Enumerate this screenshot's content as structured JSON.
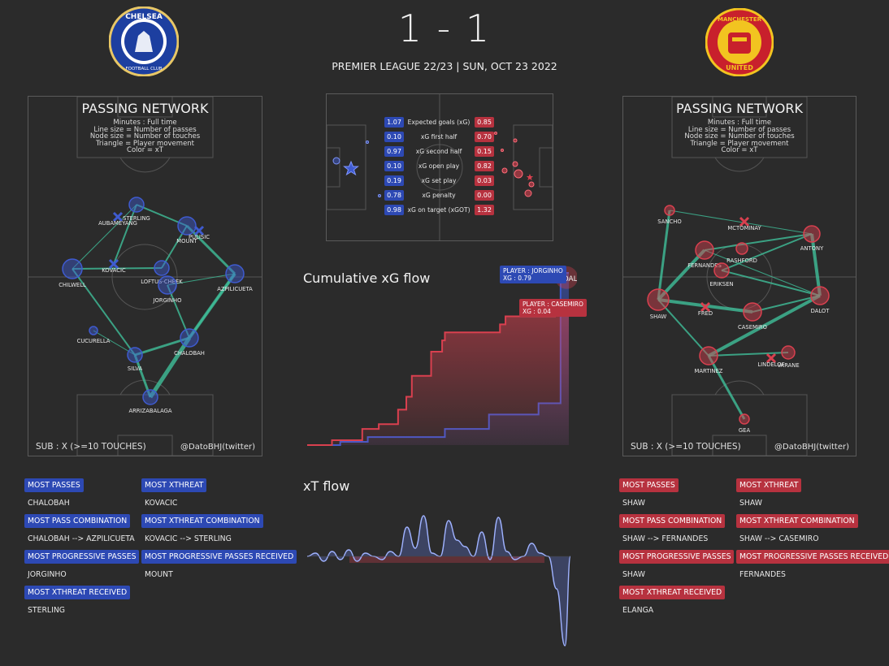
{
  "header": {
    "score": "1 - 1",
    "subtitle": "PREMIER LEAGUE 22/23 | SUN, OCT 23 2022",
    "home_crest_text": [
      "CHELSEA",
      "FOOTBALL CLUB"
    ],
    "away_crest_text": [
      "MANCHESTER",
      "UNITED"
    ]
  },
  "colors": {
    "background": "#2b2b2b",
    "home": "#3f5bd0",
    "away": "#d9404f",
    "link": "#3fbf9a"
  },
  "home_network": {
    "title": "PASSING NETWORK",
    "legend": [
      "Minutes : Full time",
      "Line size = Number of passes",
      "Node size = Number of touches",
      "Triangle = Player movement",
      "Color = xT"
    ],
    "sub_note": "SUB : X (>=10 TOUCHES)",
    "credit": "@DatoBHJ(twitter)",
    "players": [
      {
        "name": "STERLING"
      },
      {
        "name": "AUBAMEYANG"
      },
      {
        "name": "MOUNT"
      },
      {
        "name": "PULISIC"
      },
      {
        "name": "CHILWELL"
      },
      {
        "name": "KOVACIC"
      },
      {
        "name": "LOFTUS-CHEEK"
      },
      {
        "name": "AZPILICUETA"
      },
      {
        "name": "JORGINHO"
      },
      {
        "name": "CUCURELLA"
      },
      {
        "name": "CHALOBAH"
      },
      {
        "name": "SILVA"
      },
      {
        "name": "ARRIZABALAGA"
      }
    ]
  },
  "away_network": {
    "title": "PASSING NETWORK",
    "legend": [
      "Minutes : Full time",
      "Line size = Number of passes",
      "Node size = Number of touches",
      "Triangle = Player movement",
      "Color = xT"
    ],
    "sub_note": "SUB : X (>=10 TOUCHES)",
    "credit": "@DatoBHJ(twitter)",
    "players": [
      {
        "name": "SANCHO"
      },
      {
        "name": "MCTOMINAY"
      },
      {
        "name": "ANTONY"
      },
      {
        "name": "FERNANDES"
      },
      {
        "name": "RASHFORD"
      },
      {
        "name": "ERIKSEN"
      },
      {
        "name": "SHAW"
      },
      {
        "name": "FRED"
      },
      {
        "name": "CASEMIRO"
      },
      {
        "name": "DALOT"
      },
      {
        "name": "MARTINEZ"
      },
      {
        "name": "VARANE"
      },
      {
        "name": "LINDELOF"
      },
      {
        "name": "GEA"
      }
    ]
  },
  "xg_table": {
    "rows": [
      {
        "label": "Expected goals (xG)",
        "home": "1.07",
        "away": "0.85"
      },
      {
        "label": "xG first half",
        "home": "0.10",
        "away": "0.70"
      },
      {
        "label": "xG second half",
        "home": "0.97",
        "away": "0.15"
      },
      {
        "label": "xG open play",
        "home": "0.10",
        "away": "0.82"
      },
      {
        "label": "xG set play",
        "home": "0.19",
        "away": "0.03"
      },
      {
        "label": "xG penalty",
        "home": "0.78",
        "away": "0.00"
      },
      {
        "label": "xG on target (xGOT)",
        "home": "0.98",
        "away": "1.32"
      }
    ]
  },
  "xg_flow": {
    "title": "Cumulative xG flow",
    "goal_label": "GOAL",
    "tooltip_home": [
      "PLAYER : JORGINHO",
      "XG : 0.79"
    ],
    "tooltip_away": [
      "PLAYER : CASEMIRO",
      "XG : 0.04"
    ]
  },
  "xt_flow": {
    "title": "xT flow"
  },
  "home_stats": [
    {
      "label": "MOST PASSES",
      "value": "CHALOBAH"
    },
    {
      "label": "MOST XTHREAT",
      "value": "KOVACIC"
    },
    {
      "label": "MOST PASS COMBINATION",
      "value": "CHALOBAH --> AZPILICUETA"
    },
    {
      "label": "MOST XTHREAT COMBINATION",
      "value": "KOVACIC --> STERLING"
    },
    {
      "label": "MOST PROGRESSIVE PASSES",
      "value": "JORGINHO"
    },
    {
      "label": "MOST PROGRESSIVE PASSES RECEIVED",
      "value": "MOUNT"
    },
    {
      "label": "MOST XTHREAT RECEIVED",
      "value": "STERLING"
    }
  ],
  "away_stats": [
    {
      "label": "MOST PASSES",
      "value": "SHAW"
    },
    {
      "label": "MOST XTHREAT",
      "value": "SHAW"
    },
    {
      "label": "MOST PASS COMBINATION",
      "value": "SHAW --> FERNANDES"
    },
    {
      "label": "MOST XTHREAT COMBINATION",
      "value": "SHAW --> CASEMIRO"
    },
    {
      "label": "MOST PROGRESSIVE PASSES",
      "value": "SHAW"
    },
    {
      "label": "MOST PROGRESSIVE PASSES RECEIVED",
      "value": "FERNANDES"
    },
    {
      "label": "MOST XTHREAT RECEIVED",
      "value": "ELANGA"
    }
  ],
  "chart_data": [
    {
      "type": "line",
      "title": "Cumulative xG flow",
      "series": [
        {
          "name": "",
          "color": "#3f5bd0",
          "points": [
            [
              0,
              0
            ],
            [
              12,
              0.02
            ],
            [
              22,
              0.05
            ],
            [
              35,
              0.05
            ],
            [
              50,
              0.1
            ],
            [
              62,
              0.1
            ],
            [
              66,
              0.19
            ],
            [
              80,
              0.19
            ],
            [
              84,
              0.26
            ],
            [
              91,
              0.26
            ],
            [
              92,
              1.07
            ],
            [
              95,
              1.07
            ]
          ]
        },
        {
          "name": "",
          "color": "#d9404f",
          "points": [
            [
              0,
              0
            ],
            [
              9,
              0.03
            ],
            [
              20,
              0.1
            ],
            [
              26,
              0.13
            ],
            [
              33,
              0.22
            ],
            [
              36,
              0.3
            ],
            [
              38,
              0.43
            ],
            [
              45,
              0.58
            ],
            [
              49,
              0.65
            ],
            [
              50,
              0.7
            ],
            [
              60,
              0.7
            ],
            [
              70,
              0.75
            ],
            [
              72,
              0.8
            ],
            [
              90,
              0.85
            ],
            [
              95,
              0.85
            ]
          ]
        }
      ],
      "ylim": [
        0,
        1.1
      ],
      "xlim": [
        0,
        95
      ]
    },
    {
      "type": "area",
      "title": "xT flow",
      "x": [
        0,
        3,
        6,
        9,
        12,
        15,
        18,
        21,
        24,
        27,
        30,
        33,
        36,
        39,
        42,
        45,
        48,
        51,
        54,
        57,
        60,
        63,
        66,
        69,
        72,
        75,
        78,
        81,
        84,
        87,
        90,
        93,
        95
      ],
      "values": [
        0,
        0.02,
        -0.03,
        0.03,
        -0.02,
        0.04,
        -0.03,
        0.02,
        0.0,
        -0.02,
        0.03,
        0.0,
        0.18,
        0.05,
        0.25,
        0.02,
        0.0,
        0.22,
        0.1,
        0.06,
        0.0,
        0.15,
        -0.02,
        0.24,
        0.03,
        -0.02,
        0.0,
        0.08,
        0.02,
        0.0,
        -0.2,
        -0.55,
        0.0
      ],
      "ylim": [
        -0.6,
        0.35
      ]
    }
  ]
}
